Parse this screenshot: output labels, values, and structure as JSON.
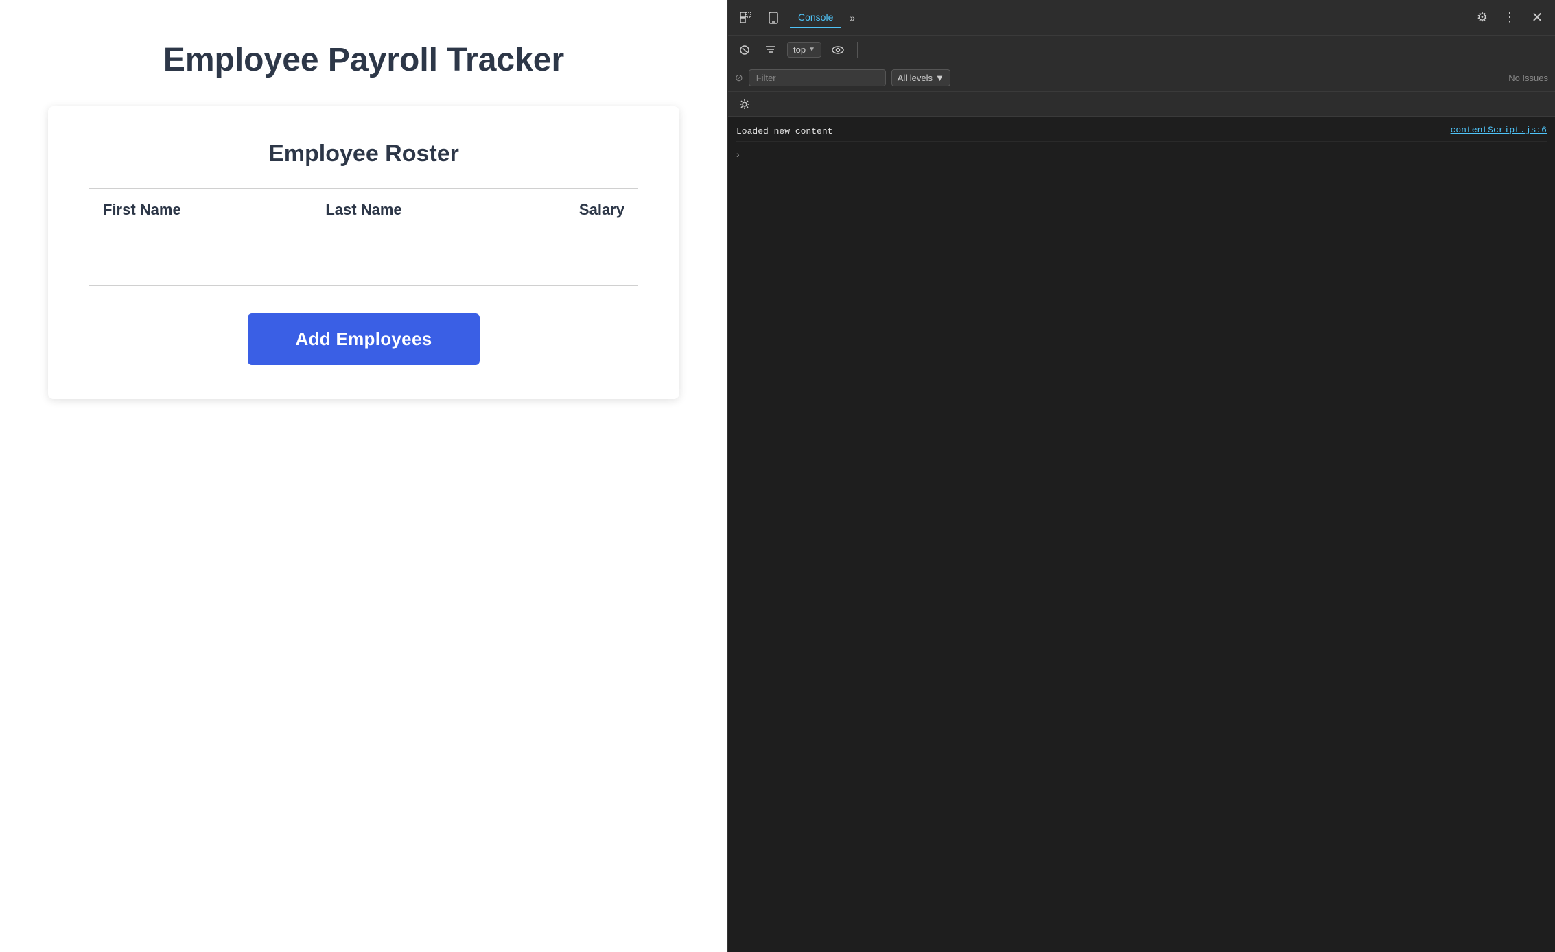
{
  "page": {
    "title": "Employee Payroll Tracker",
    "card": {
      "roster_title": "Employee Roster",
      "table": {
        "columns": [
          "First Name",
          "Last Name",
          "Salary"
        ]
      },
      "add_button_label": "Add Employees"
    }
  },
  "devtools": {
    "tabs": [
      {
        "label": "Console",
        "active": true
      },
      {
        "label": "»"
      }
    ],
    "toolbar": {
      "gear_label": "⚙",
      "dots_label": "⋮",
      "close_label": "✕",
      "inspect_label": "🔲",
      "device_label": "📱"
    },
    "context": {
      "label": "top"
    },
    "filter": {
      "placeholder": "Filter",
      "level_label": "All levels",
      "no_issues_label": "No Issues"
    },
    "console_entries": [
      {
        "text": "Loaded new content",
        "source": "contentScript.js:6"
      }
    ]
  }
}
